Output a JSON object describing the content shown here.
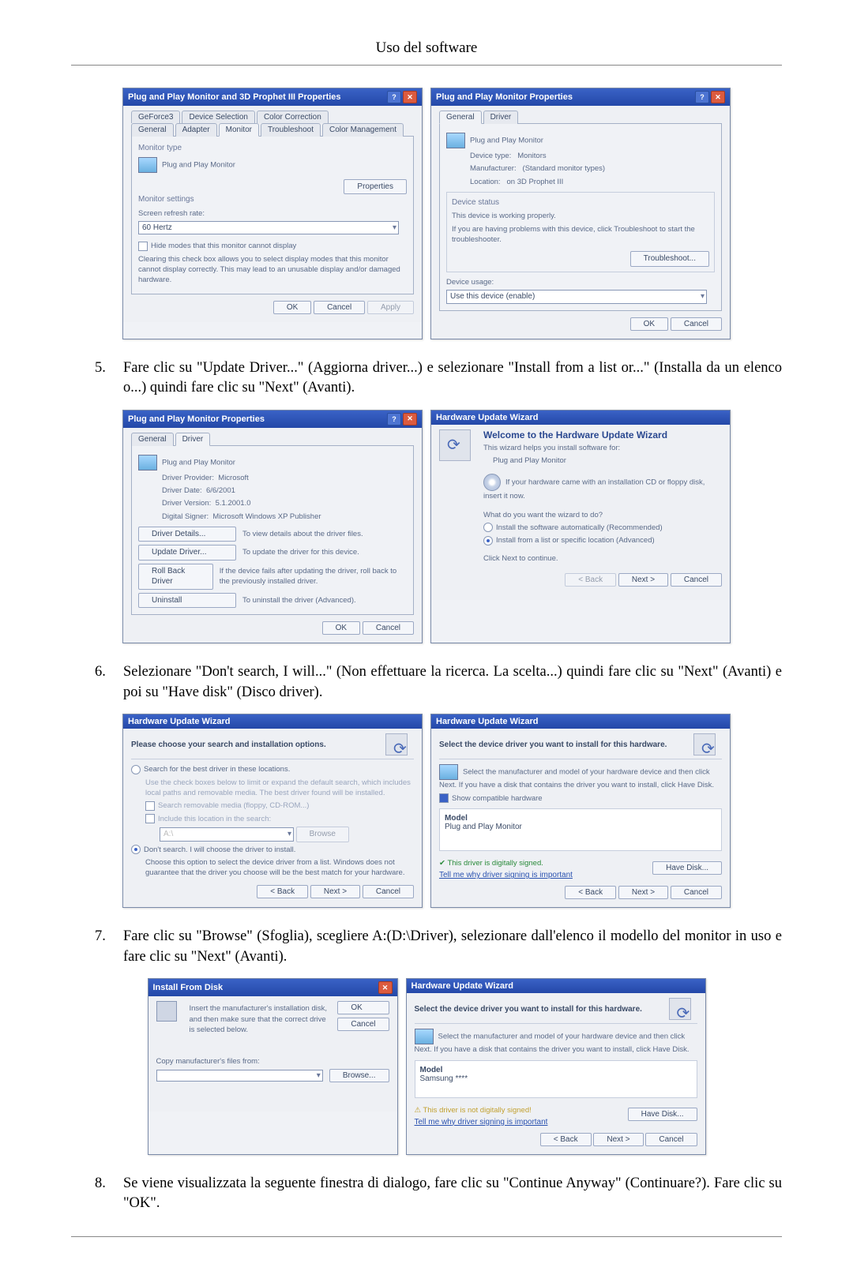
{
  "header": "Uso del software",
  "step5": {
    "num": "5.",
    "text": "Fare clic su \"Update Driver...\" (Aggiorna driver...) e selezionare \"Install from a list or...\" (Installa da un elenco o...) quindi fare clic su \"Next\" (Avanti)."
  },
  "step6": {
    "num": "6.",
    "text": "Selezionare \"Don't search, I will...\" (Non effettuare la ricerca. La scelta...) quindi fare clic su \"Next\" (Avanti) e poi su \"Have disk\" (Disco driver)."
  },
  "step7": {
    "num": "7.",
    "text": "Fare clic su \"Browse\" (Sfoglia), scegliere A:(D:\\Driver), selezionare dall'elenco il modello del monitor in uso e fare clic su \"Next\" (Avanti)."
  },
  "step8": {
    "num": "8.",
    "text": "Se viene visualizzata la seguente finestra di dialogo, fare clic su \"Continue Anyway\" (Continuare?). Fare clic su \"OK\"."
  },
  "dlg_a1": {
    "title": "Plug and Play Monitor and 3D Prophet III Properties",
    "tabs": [
      "GeForce3",
      "Device Selection",
      "Color Correction"
    ],
    "tabs2": [
      "General",
      "Adapter",
      "Monitor",
      "Troubleshoot",
      "Color Management"
    ],
    "section": "Monitor type",
    "monitor": "Plug and Play Monitor",
    "props_btn": "Properties",
    "settings": "Monitor settings",
    "refresh": "Screen refresh rate:",
    "hz": "60 Hertz",
    "hide": "Hide modes that this monitor cannot display",
    "hide_desc": "Clearing this check box allows you to select display modes that this monitor cannot display correctly. This may lead to an unusable display and/or damaged hardware.",
    "ok": "OK",
    "cancel": "Cancel",
    "apply": "Apply"
  },
  "dlg_a2": {
    "title": "Plug and Play Monitor Properties",
    "tabs": [
      "General",
      "Driver"
    ],
    "monitor": "Plug and Play Monitor",
    "devtype_l": "Device type:",
    "devtype_v": "Monitors",
    "manu_l": "Manufacturer:",
    "manu_v": "(Standard monitor types)",
    "loc_l": "Location:",
    "loc_v": "on 3D Prophet III",
    "status_h": "Device status",
    "status1": "This device is working properly.",
    "status2": "If you are having problems with this device, click Troubleshoot to start the troubleshooter.",
    "trouble": "Troubleshoot...",
    "usage_l": "Device usage:",
    "usage_v": "Use this device (enable)",
    "ok": "OK",
    "cancel": "Cancel"
  },
  "dlg_b1": {
    "title": "Plug and Play Monitor Properties",
    "tabs": [
      "General",
      "Driver"
    ],
    "monitor": "Plug and Play Monitor",
    "prov_l": "Driver Provider:",
    "prov_v": "Microsoft",
    "date_l": "Driver Date:",
    "date_v": "6/6/2001",
    "ver_l": "Driver Version:",
    "ver_v": "5.1.2001.0",
    "sign_l": "Digital Signer:",
    "sign_v": "Microsoft Windows XP Publisher",
    "btn_details": "Driver Details...",
    "btn_details_d": "To view details about the driver files.",
    "btn_update": "Update Driver...",
    "btn_update_d": "To update the driver for this device.",
    "btn_roll": "Roll Back Driver",
    "btn_roll_d": "If the device fails after updating the driver, roll back to the previously installed driver.",
    "btn_un": "Uninstall",
    "btn_un_d": "To uninstall the driver (Advanced).",
    "ok": "OK",
    "cancel": "Cancel"
  },
  "dlg_b2": {
    "title": "Hardware Update Wizard",
    "welcome": "Welcome to the Hardware Update Wizard",
    "desc": "This wizard helps you install software for:",
    "dev": "Plug and Play Monitor",
    "hint": "If your hardware came with an installation CD or floppy disk, insert it now.",
    "q": "What do you want the wizard to do?",
    "r1": "Install the software automatically (Recommended)",
    "r2": "Install from a list or specific location (Advanced)",
    "cont": "Click Next to continue.",
    "back": "< Back",
    "next": "Next >",
    "cancel": "Cancel"
  },
  "dlg_c1": {
    "title": "Hardware Update Wizard",
    "head": "Please choose your search and installation options.",
    "r1": "Search for the best driver in these locations.",
    "r1d": "Use the check boxes below to limit or expand the default search, which includes local paths and removable media. The best driver found will be installed.",
    "c1": "Search removable media (floppy, CD-ROM...)",
    "c2": "Include this location in the search:",
    "path": "A:\\",
    "browse": "Browse",
    "r2": "Don't search. I will choose the driver to install.",
    "r2d": "Choose this option to select the device driver from a list. Windows does not guarantee that the driver you choose will be the best match for your hardware.",
    "back": "< Back",
    "next": "Next >",
    "cancel": "Cancel"
  },
  "dlg_c2": {
    "title": "Hardware Update Wizard",
    "head": "Select the device driver you want to install for this hardware.",
    "desc": "Select the manufacturer and model of your hardware device and then click Next. If you have a disk that contains the driver you want to install, click Have Disk.",
    "compat": "Show compatible hardware",
    "model_h": "Model",
    "model_v": "Plug and Play Monitor",
    "signed": "This driver is digitally signed.",
    "tell": "Tell me why driver signing is important",
    "have": "Have Disk...",
    "back": "< Back",
    "next": "Next >",
    "cancel": "Cancel"
  },
  "dlg_d1": {
    "title": "Install From Disk",
    "text": "Insert the manufacturer's installation disk, and then make sure that the correct drive is selected below.",
    "ok": "OK",
    "cancel": "Cancel",
    "copy": "Copy manufacturer's files from:",
    "browse": "Browse..."
  },
  "dlg_d2": {
    "title": "Hardware Update Wizard",
    "head": "Select the device driver you want to install for this hardware.",
    "desc": "Select the manufacturer and model of your hardware device and then click Next. If you have a disk that contains the driver you want to install, click Have Disk.",
    "model_h": "Model",
    "model_v": "Samsung ****",
    "signed": "This driver is not digitally signed!",
    "tell": "Tell me why driver signing is important",
    "have": "Have Disk...",
    "back": "< Back",
    "next": "Next >",
    "cancel": "Cancel"
  }
}
